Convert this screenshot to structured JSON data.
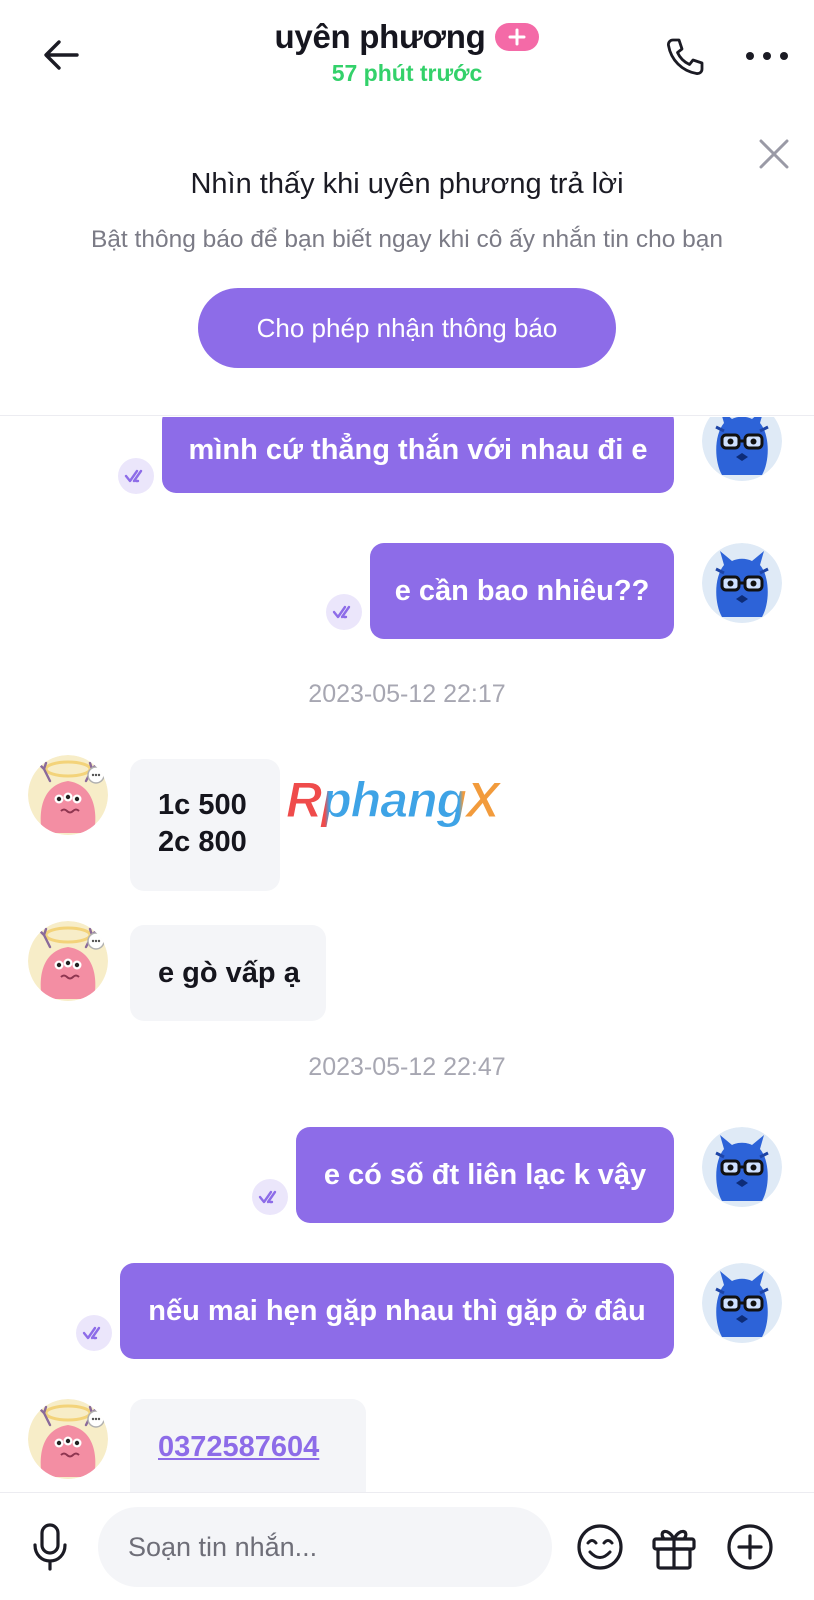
{
  "header": {
    "title": "uyên phương",
    "status": "57 phút trước"
  },
  "banner": {
    "title": "Nhìn thấy khi uyên phương trả lời",
    "subtitle": "Bật thông báo để bạn biết ngay khi cô ấy nhắn tin cho bạn",
    "button_label": "Cho phép nhận thông báo"
  },
  "messages": [
    {
      "from": "me",
      "text": "mình cứ thẳng thắn với nhau đi e",
      "read": true
    },
    {
      "from": "me",
      "text": "e cần bao nhiêu??",
      "read": true
    },
    {
      "type": "timestamp",
      "text": "2023-05-12 22:17"
    },
    {
      "from": "them",
      "lines": [
        "1c 500",
        "2c 800"
      ]
    },
    {
      "from": "them",
      "text": "e gò vấp ạ"
    },
    {
      "type": "timestamp",
      "text": "2023-05-12 22:47"
    },
    {
      "from": "me",
      "text": "e có số đt liên lạc k vậy",
      "read": true
    },
    {
      "from": "me",
      "text": "nếu mai hẹn gặp nhau thì gặp ở đâu",
      "read": true
    },
    {
      "from": "them",
      "text": "0372587604",
      "is_link": true
    }
  ],
  "watermark": "RphangX",
  "composer": {
    "placeholder": "Soạn tin nhắn..."
  },
  "colors": {
    "accent": "#8d6ce8",
    "online": "#33d16a",
    "badge": "#f46aa7",
    "incoming_bubble": "#f4f5f8"
  },
  "icons": {
    "back": "arrow-left-icon",
    "call": "phone-icon",
    "more": "more-horizontal-icon",
    "close": "close-icon",
    "read": "double-check-icon",
    "mic": "microphone-icon",
    "emoji": "emoji-icon",
    "gift": "gift-icon",
    "add": "plus-circle-icon"
  }
}
